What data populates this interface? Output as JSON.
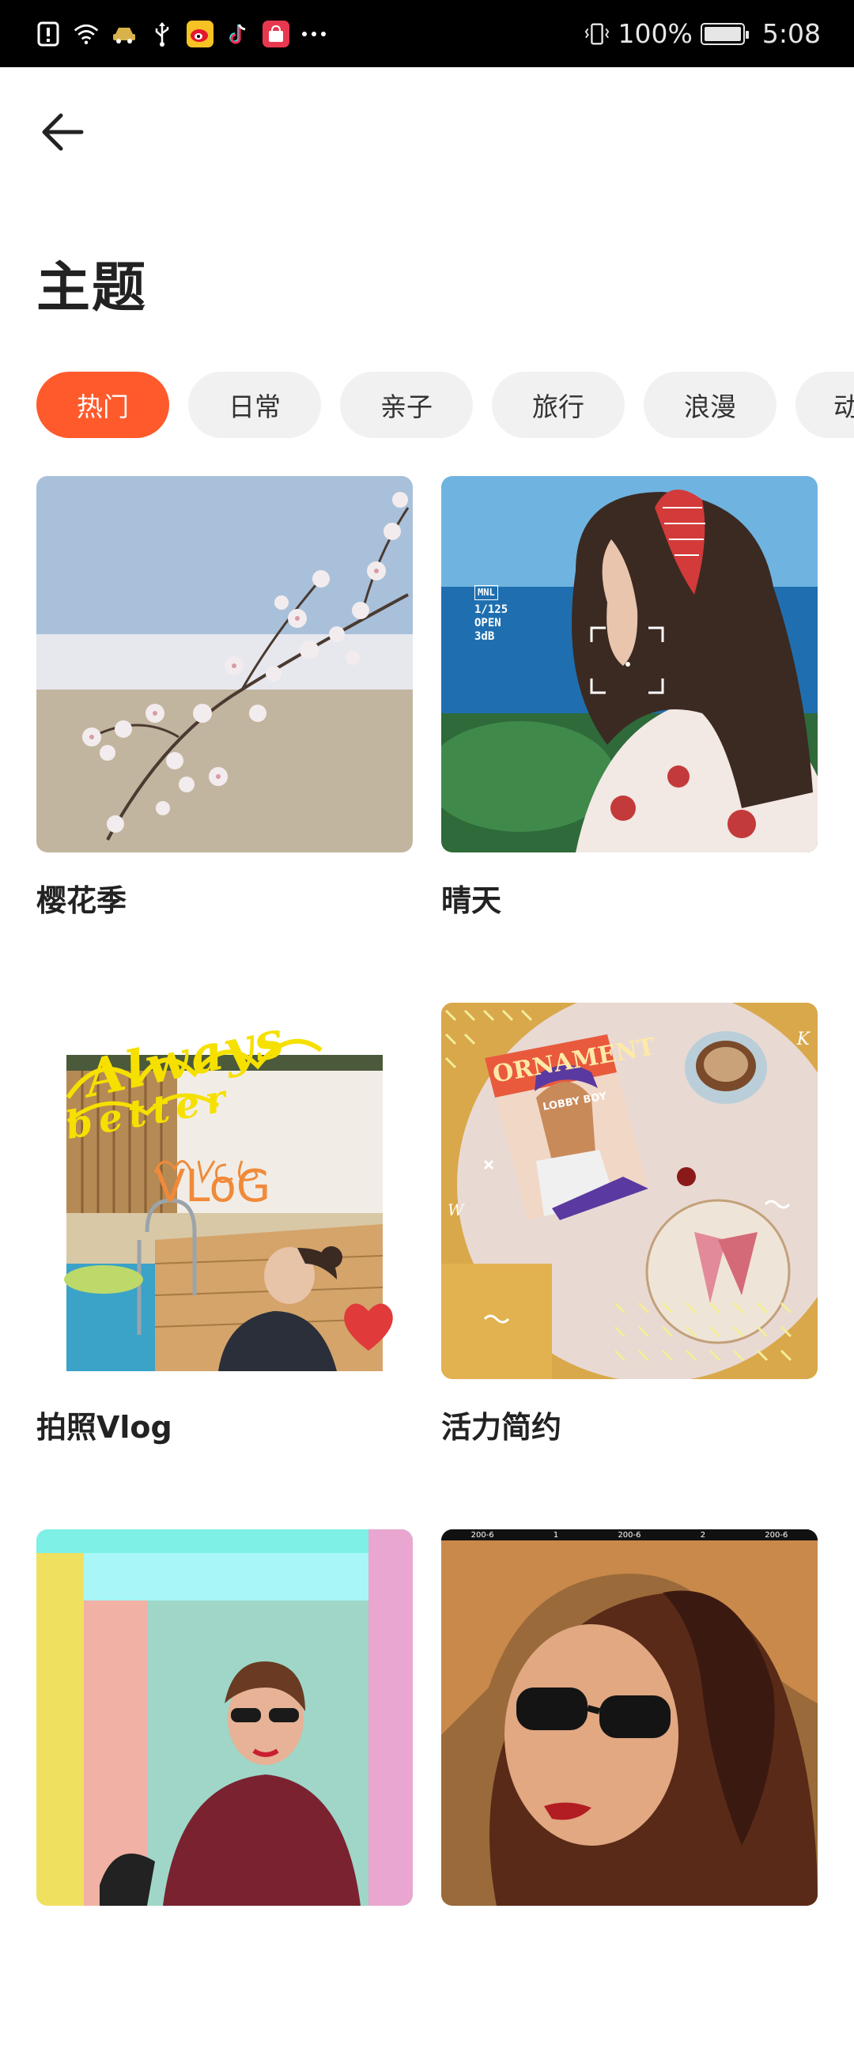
{
  "status_bar": {
    "battery_text": "100%",
    "time": "5:08",
    "icons": [
      "alert-icon",
      "wifi-icon",
      "car-icon",
      "usb-icon",
      "weibo-icon",
      "tiktok-icon",
      "shop-icon",
      "more-icon",
      "vibrate-icon",
      "battery-icon"
    ]
  },
  "header": {
    "back_icon": "back-arrow-icon",
    "title": "主题"
  },
  "tabs": [
    {
      "label": "热门",
      "active": true
    },
    {
      "label": "日常",
      "active": false
    },
    {
      "label": "亲子",
      "active": false
    },
    {
      "label": "旅行",
      "active": false
    },
    {
      "label": "浪漫",
      "active": false
    },
    {
      "label": "动",
      "active": false
    }
  ],
  "themes": [
    {
      "name": "樱花季"
    },
    {
      "name": "晴天",
      "overlay": {
        "brand": "MNL",
        "shutter": "1/125",
        "mode": "OPEN",
        "gain": "3dB"
      }
    },
    {
      "name": "拍照Vlog",
      "overlay": {
        "script": "Always",
        "script2": "better",
        "tag": "VLoG"
      }
    },
    {
      "name": "活力简约",
      "overlay": {
        "book_title": "ORNAMENT",
        "book_sub": "LOBBY BOY",
        "mark_k": "K",
        "mark_w": "W"
      }
    },
    {
      "name": ""
    },
    {
      "name": "",
      "overlay": {
        "ruler": [
          "200-6",
          "1",
          "200-6",
          "2",
          "200-6"
        ]
      }
    }
  ],
  "colors": {
    "accent": "#ff5a2c",
    "tab_bg": "#f1f1f1",
    "title": "#222222"
  }
}
